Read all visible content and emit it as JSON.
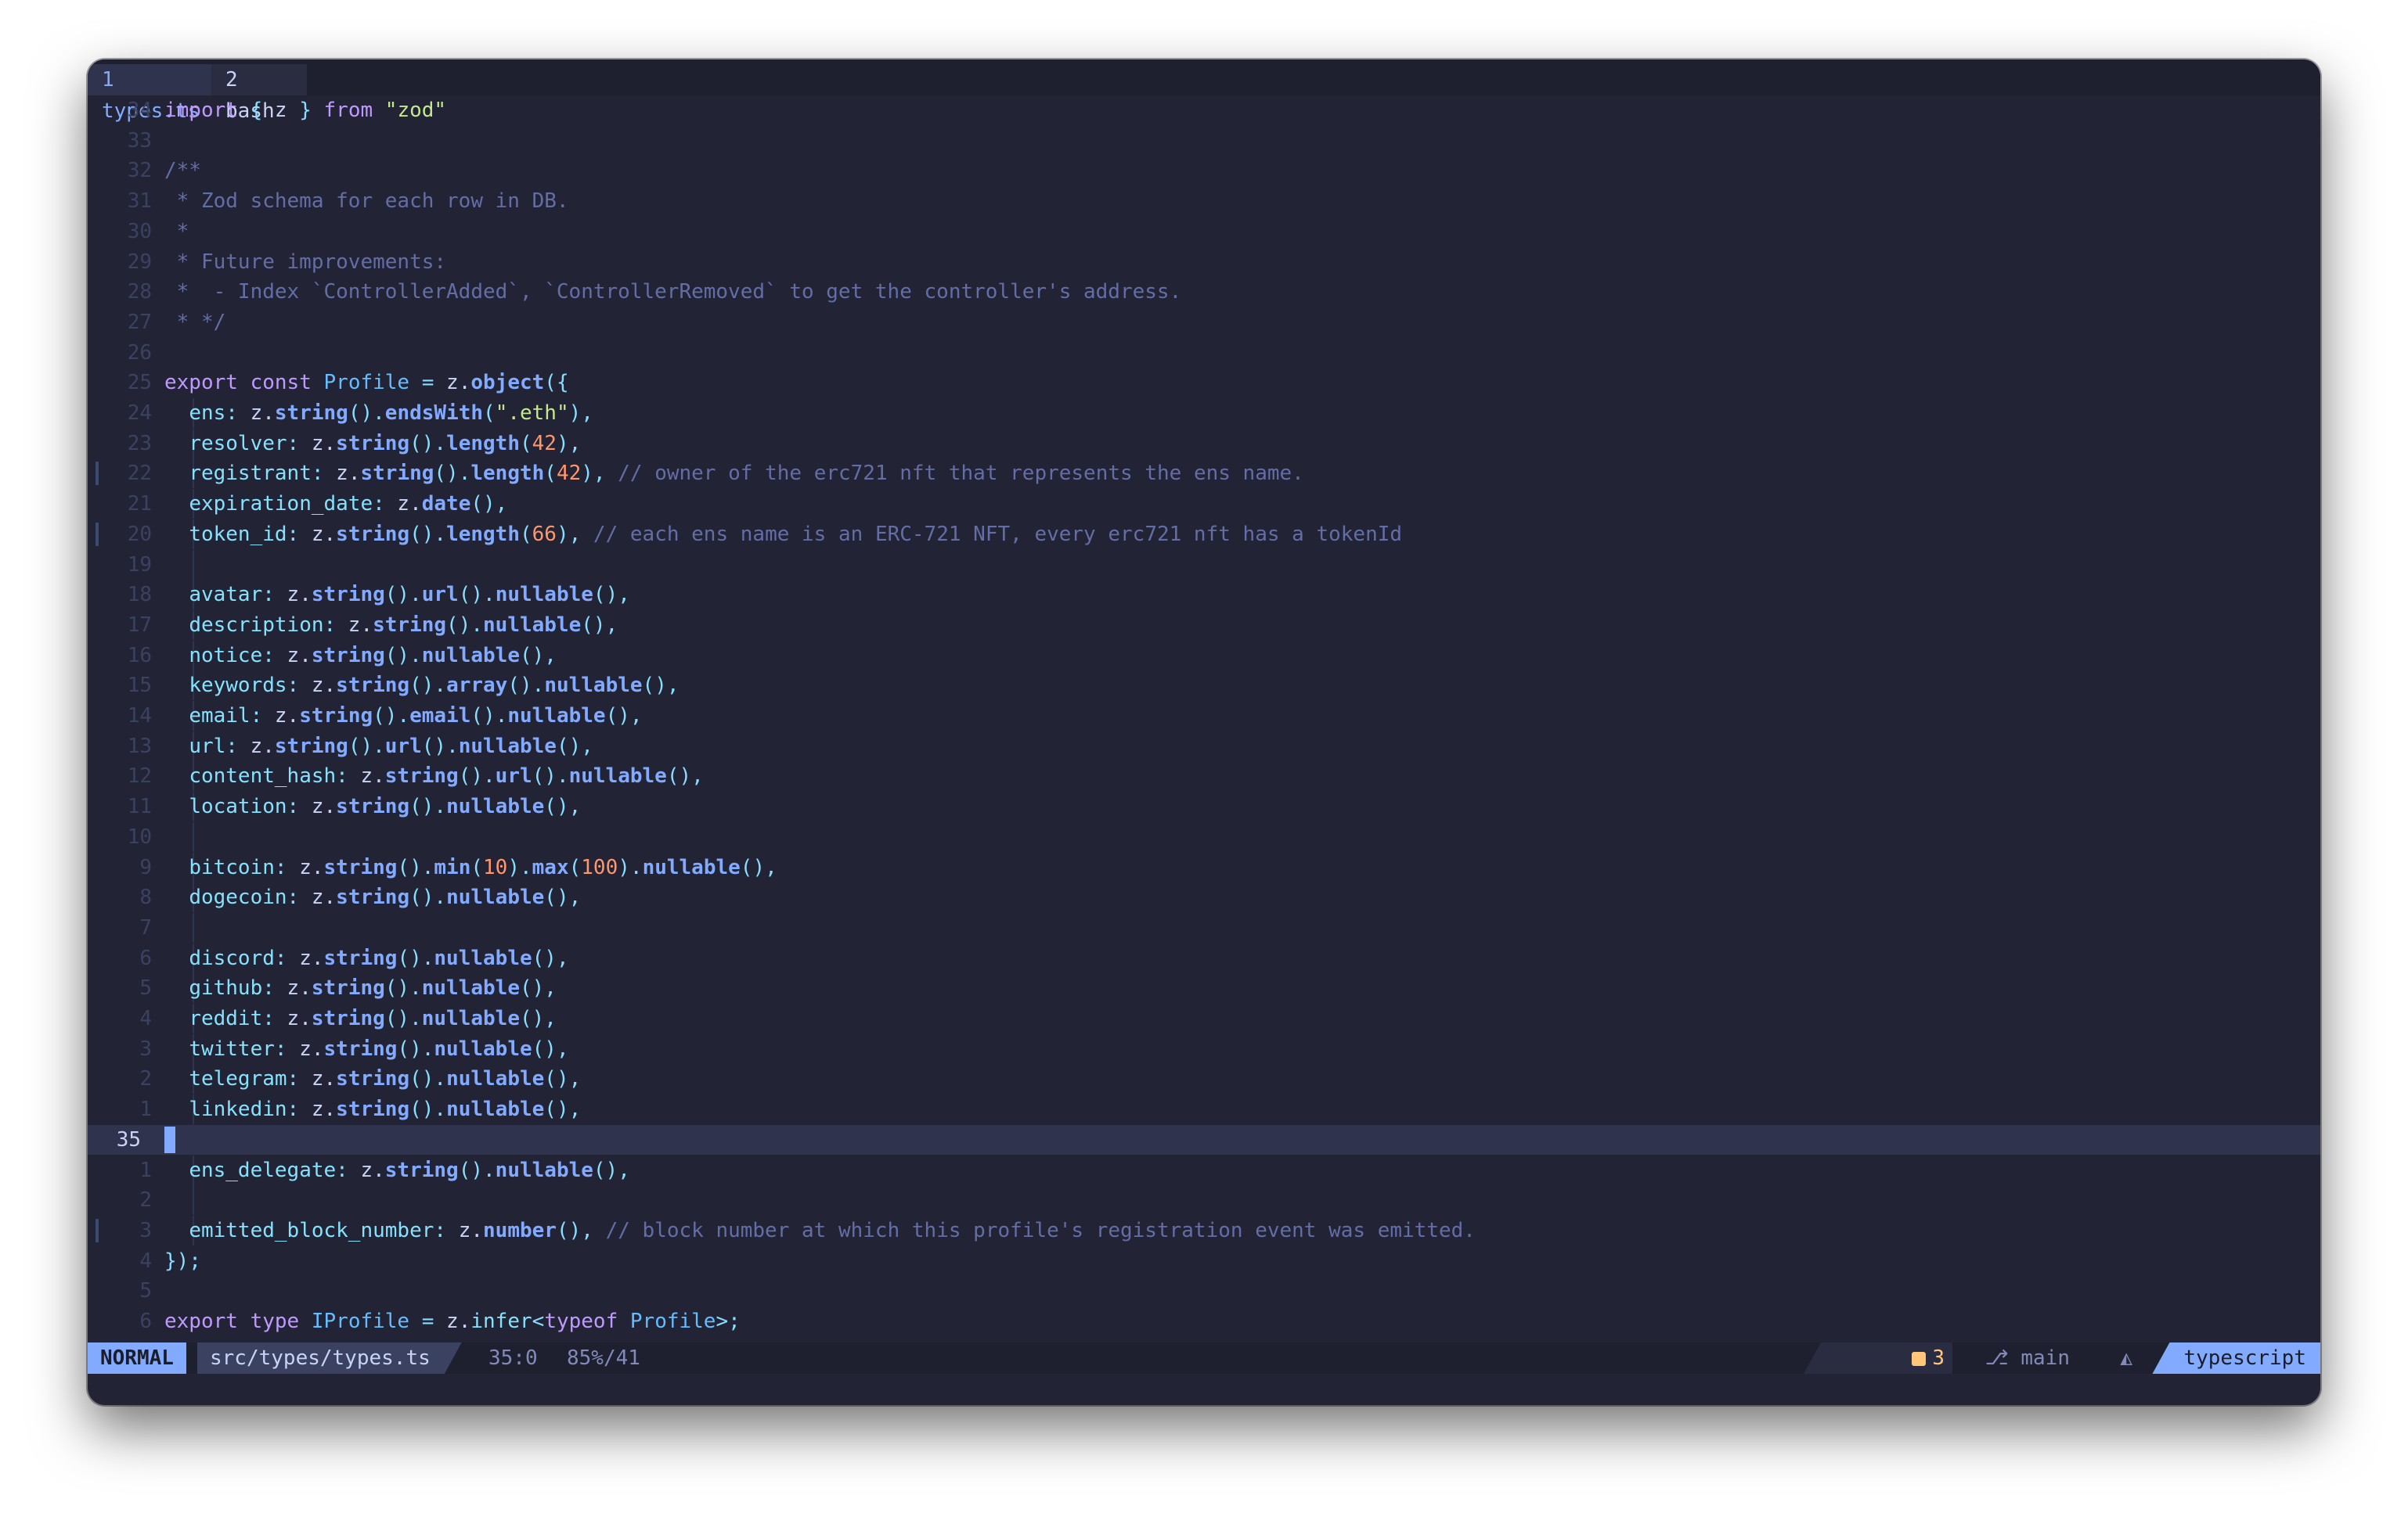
{
  "tabs": [
    {
      "label": "1 types.ts"
    },
    {
      "label": "2 bash"
    }
  ],
  "lines": [
    {
      "num": "34",
      "parts": [
        [
          "kw",
          "import"
        ],
        [
          "",
          " "
        ],
        [
          "pun",
          "{"
        ],
        [
          "",
          " z "
        ],
        [
          "pun",
          "}"
        ],
        [
          "",
          " "
        ],
        [
          "kw",
          "from"
        ],
        [
          "",
          " "
        ],
        [
          "str",
          "\"zod\""
        ]
      ]
    },
    {
      "num": "33",
      "parts": []
    },
    {
      "num": "32",
      "parts": [
        [
          "cmt",
          "/**"
        ]
      ]
    },
    {
      "num": "31",
      "parts": [
        [
          "cmt",
          " * Zod schema for each row in DB."
        ]
      ]
    },
    {
      "num": "30",
      "parts": [
        [
          "cmt",
          " *"
        ]
      ]
    },
    {
      "num": "29",
      "parts": [
        [
          "cmt",
          " * Future improvements:"
        ]
      ]
    },
    {
      "num": "28",
      "parts": [
        [
          "cmt",
          " *  - Index `ControllerAdded`, `ControllerRemoved` to get the controller's address."
        ]
      ]
    },
    {
      "num": "27",
      "parts": [
        [
          "cmt",
          " * */"
        ]
      ]
    },
    {
      "num": "26",
      "parts": []
    },
    {
      "num": "25",
      "parts": [
        [
          "kw",
          "export"
        ],
        [
          "",
          " "
        ],
        [
          "kw",
          "const"
        ],
        [
          "",
          " "
        ],
        [
          "typ",
          "Profile"
        ],
        [
          "",
          " "
        ],
        [
          "pun",
          "="
        ],
        [
          "",
          " z."
        ],
        [
          "fn",
          "object"
        ],
        [
          "pun",
          "({"
        ]
      ]
    },
    {
      "num": "24",
      "guide": true,
      "parts": [
        [
          "",
          "  "
        ],
        [
          "prop",
          "ens"
        ],
        [
          "pun",
          ":"
        ],
        [
          "",
          " z."
        ],
        [
          "fn",
          "string"
        ],
        [
          "pun",
          "()."
        ],
        [
          "fn",
          "endsWith"
        ],
        [
          "pun",
          "("
        ],
        [
          "str",
          "\".eth\""
        ],
        [
          "pun",
          "),"
        ]
      ]
    },
    {
      "num": "23",
      "guide": true,
      "parts": [
        [
          "",
          "  "
        ],
        [
          "prop",
          "resolver"
        ],
        [
          "pun",
          ":"
        ],
        [
          "",
          " z."
        ],
        [
          "fn",
          "string"
        ],
        [
          "pun",
          "()."
        ],
        [
          "fn",
          "length"
        ],
        [
          "pun",
          "("
        ],
        [
          "num",
          "42"
        ],
        [
          "pun",
          "),"
        ]
      ]
    },
    {
      "num": "22",
      "guide": true,
      "mark": true,
      "parts": [
        [
          "",
          "  "
        ],
        [
          "prop",
          "registrant"
        ],
        [
          "pun",
          ":"
        ],
        [
          "",
          " z."
        ],
        [
          "fn",
          "string"
        ],
        [
          "pun",
          "()."
        ],
        [
          "fn",
          "length"
        ],
        [
          "pun",
          "("
        ],
        [
          "num",
          "42"
        ],
        [
          "pun",
          "),"
        ],
        [
          "",
          " "
        ],
        [
          "cmt",
          "// owner of the erc721 nft that represents the ens name."
        ]
      ]
    },
    {
      "num": "21",
      "guide": true,
      "parts": [
        [
          "",
          "  "
        ],
        [
          "prop",
          "expiration_date"
        ],
        [
          "pun",
          ":"
        ],
        [
          "",
          " z."
        ],
        [
          "fn",
          "date"
        ],
        [
          "pun",
          "(),"
        ]
      ]
    },
    {
      "num": "20",
      "guide": true,
      "mark": true,
      "parts": [
        [
          "",
          "  "
        ],
        [
          "prop",
          "token_id"
        ],
        [
          "pun",
          ":"
        ],
        [
          "",
          " z."
        ],
        [
          "fn",
          "string"
        ],
        [
          "pun",
          "()."
        ],
        [
          "fn",
          "length"
        ],
        [
          "pun",
          "("
        ],
        [
          "num",
          "66"
        ],
        [
          "pun",
          "),"
        ],
        [
          "",
          " "
        ],
        [
          "cmt",
          "// each ens name is an ERC-721 NFT, every erc721 nft has a tokenId"
        ]
      ]
    },
    {
      "num": "19",
      "guide": true,
      "parts": []
    },
    {
      "num": "18",
      "guide": true,
      "parts": [
        [
          "",
          "  "
        ],
        [
          "prop",
          "avatar"
        ],
        [
          "pun",
          ":"
        ],
        [
          "",
          " z."
        ],
        [
          "fn",
          "string"
        ],
        [
          "pun",
          "()."
        ],
        [
          "fn",
          "url"
        ],
        [
          "pun",
          "()."
        ],
        [
          "fn",
          "nullable"
        ],
        [
          "pun",
          "(),"
        ]
      ]
    },
    {
      "num": "17",
      "guide": true,
      "parts": [
        [
          "",
          "  "
        ],
        [
          "prop",
          "description"
        ],
        [
          "pun",
          ":"
        ],
        [
          "",
          " z."
        ],
        [
          "fn",
          "string"
        ],
        [
          "pun",
          "()."
        ],
        [
          "fn",
          "nullable"
        ],
        [
          "pun",
          "(),"
        ]
      ]
    },
    {
      "num": "16",
      "guide": true,
      "parts": [
        [
          "",
          "  "
        ],
        [
          "prop",
          "notice"
        ],
        [
          "pun",
          ":"
        ],
        [
          "",
          " z."
        ],
        [
          "fn",
          "string"
        ],
        [
          "pun",
          "()."
        ],
        [
          "fn",
          "nullable"
        ],
        [
          "pun",
          "(),"
        ]
      ]
    },
    {
      "num": "15",
      "guide": true,
      "parts": [
        [
          "",
          "  "
        ],
        [
          "prop",
          "keywords"
        ],
        [
          "pun",
          ":"
        ],
        [
          "",
          " z."
        ],
        [
          "fn",
          "string"
        ],
        [
          "pun",
          "()."
        ],
        [
          "fn",
          "array"
        ],
        [
          "pun",
          "()."
        ],
        [
          "fn",
          "nullable"
        ],
        [
          "pun",
          "(),"
        ]
      ]
    },
    {
      "num": "14",
      "guide": true,
      "parts": [
        [
          "",
          "  "
        ],
        [
          "prop",
          "email"
        ],
        [
          "pun",
          ":"
        ],
        [
          "",
          " z."
        ],
        [
          "fn",
          "string"
        ],
        [
          "pun",
          "()."
        ],
        [
          "fn",
          "email"
        ],
        [
          "pun",
          "()."
        ],
        [
          "fn",
          "nullable"
        ],
        [
          "pun",
          "(),"
        ]
      ]
    },
    {
      "num": "13",
      "guide": true,
      "parts": [
        [
          "",
          "  "
        ],
        [
          "prop",
          "url"
        ],
        [
          "pun",
          ":"
        ],
        [
          "",
          " z."
        ],
        [
          "fn",
          "string"
        ],
        [
          "pun",
          "()."
        ],
        [
          "fn",
          "url"
        ],
        [
          "pun",
          "()."
        ],
        [
          "fn",
          "nullable"
        ],
        [
          "pun",
          "(),"
        ]
      ]
    },
    {
      "num": "12",
      "guide": true,
      "parts": [
        [
          "",
          "  "
        ],
        [
          "prop",
          "content_hash"
        ],
        [
          "pun",
          ":"
        ],
        [
          "",
          " z."
        ],
        [
          "fn",
          "string"
        ],
        [
          "pun",
          "()."
        ],
        [
          "fn",
          "url"
        ],
        [
          "pun",
          "()."
        ],
        [
          "fn",
          "nullable"
        ],
        [
          "pun",
          "(),"
        ]
      ]
    },
    {
      "num": "11",
      "guide": true,
      "parts": [
        [
          "",
          "  "
        ],
        [
          "prop",
          "location"
        ],
        [
          "pun",
          ":"
        ],
        [
          "",
          " z."
        ],
        [
          "fn",
          "string"
        ],
        [
          "pun",
          "()."
        ],
        [
          "fn",
          "nullable"
        ],
        [
          "pun",
          "(),"
        ]
      ]
    },
    {
      "num": "10",
      "guide": true,
      "parts": []
    },
    {
      "num": "9",
      "guide": true,
      "parts": [
        [
          "",
          "  "
        ],
        [
          "prop",
          "bitcoin"
        ],
        [
          "pun",
          ":"
        ],
        [
          "",
          " z."
        ],
        [
          "fn",
          "string"
        ],
        [
          "pun",
          "()."
        ],
        [
          "fn",
          "min"
        ],
        [
          "pun",
          "("
        ],
        [
          "num",
          "10"
        ],
        [
          "pun",
          ")."
        ],
        [
          "fn",
          "max"
        ],
        [
          "pun",
          "("
        ],
        [
          "num",
          "100"
        ],
        [
          "pun",
          ")."
        ],
        [
          "fn",
          "nullable"
        ],
        [
          "pun",
          "(),"
        ]
      ]
    },
    {
      "num": "8",
      "guide": true,
      "parts": [
        [
          "",
          "  "
        ],
        [
          "prop",
          "dogecoin"
        ],
        [
          "pun",
          ":"
        ],
        [
          "",
          " z."
        ],
        [
          "fn",
          "string"
        ],
        [
          "pun",
          "()."
        ],
        [
          "fn",
          "nullable"
        ],
        [
          "pun",
          "(),"
        ]
      ]
    },
    {
      "num": "7",
      "guide": true,
      "parts": []
    },
    {
      "num": "6",
      "guide": true,
      "parts": [
        [
          "",
          "  "
        ],
        [
          "prop",
          "discord"
        ],
        [
          "pun",
          ":"
        ],
        [
          "",
          " z."
        ],
        [
          "fn",
          "string"
        ],
        [
          "pun",
          "()."
        ],
        [
          "fn",
          "nullable"
        ],
        [
          "pun",
          "(),"
        ]
      ]
    },
    {
      "num": "5",
      "guide": true,
      "parts": [
        [
          "",
          "  "
        ],
        [
          "prop",
          "github"
        ],
        [
          "pun",
          ":"
        ],
        [
          "",
          " z."
        ],
        [
          "fn",
          "string"
        ],
        [
          "pun",
          "()."
        ],
        [
          "fn",
          "nullable"
        ],
        [
          "pun",
          "(),"
        ]
      ]
    },
    {
      "num": "4",
      "guide": true,
      "parts": [
        [
          "",
          "  "
        ],
        [
          "prop",
          "reddit"
        ],
        [
          "pun",
          ":"
        ],
        [
          "",
          " z."
        ],
        [
          "fn",
          "string"
        ],
        [
          "pun",
          "()."
        ],
        [
          "fn",
          "nullable"
        ],
        [
          "pun",
          "(),"
        ]
      ]
    },
    {
      "num": "3",
      "guide": true,
      "parts": [
        [
          "",
          "  "
        ],
        [
          "prop",
          "twitter"
        ],
        [
          "pun",
          ":"
        ],
        [
          "",
          " z."
        ],
        [
          "fn",
          "string"
        ],
        [
          "pun",
          "()."
        ],
        [
          "fn",
          "nullable"
        ],
        [
          "pun",
          "(),"
        ]
      ]
    },
    {
      "num": "2",
      "guide": true,
      "parts": [
        [
          "",
          "  "
        ],
        [
          "prop",
          "telegram"
        ],
        [
          "pun",
          ":"
        ],
        [
          "",
          " z."
        ],
        [
          "fn",
          "string"
        ],
        [
          "pun",
          "()."
        ],
        [
          "fn",
          "nullable"
        ],
        [
          "pun",
          "(),"
        ]
      ]
    },
    {
      "num": "1",
      "guide": true,
      "parts": [
        [
          "",
          "  "
        ],
        [
          "prop",
          "linkedin"
        ],
        [
          "pun",
          ":"
        ],
        [
          "",
          " z."
        ],
        [
          "fn",
          "string"
        ],
        [
          "pun",
          "()."
        ],
        [
          "fn",
          "nullable"
        ],
        [
          "pun",
          "(),"
        ]
      ]
    },
    {
      "num": "35",
      "current": true,
      "guide": true,
      "parts": []
    },
    {
      "num": "1",
      "guide": true,
      "parts": [
        [
          "",
          "  "
        ],
        [
          "prop",
          "ens_delegate"
        ],
        [
          "pun",
          ":"
        ],
        [
          "",
          " z."
        ],
        [
          "fn",
          "string"
        ],
        [
          "pun",
          "()."
        ],
        [
          "fn",
          "nullable"
        ],
        [
          "pun",
          "(),"
        ]
      ]
    },
    {
      "num": "2",
      "guide": true,
      "parts": []
    },
    {
      "num": "3",
      "guide": true,
      "mark": true,
      "parts": [
        [
          "",
          "  "
        ],
        [
          "prop",
          "emitted_block_number"
        ],
        [
          "pun",
          ":"
        ],
        [
          "",
          " z."
        ],
        [
          "fn",
          "number"
        ],
        [
          "pun",
          "(),"
        ],
        [
          "",
          " "
        ],
        [
          "cmt",
          "// block number at which this profile's registration event was emitted."
        ]
      ]
    },
    {
      "num": "4",
      "parts": [
        [
          "pun",
          "});"
        ]
      ]
    },
    {
      "num": "5",
      "parts": []
    },
    {
      "num": "6",
      "parts": [
        [
          "kw",
          "export"
        ],
        [
          "",
          " "
        ],
        [
          "kw",
          "type"
        ],
        [
          "",
          " "
        ],
        [
          "typ",
          "IProfile"
        ],
        [
          "",
          " "
        ],
        [
          "pun",
          "="
        ],
        [
          "",
          " z."
        ],
        [
          "prop",
          "infer"
        ],
        [
          "pun",
          "<"
        ],
        [
          "kw",
          "typeof"
        ],
        [
          "",
          " "
        ],
        [
          "typ",
          "Profile"
        ],
        [
          "pun",
          ">;"
        ]
      ]
    }
  ],
  "status": {
    "mode": "NORMAL",
    "file": "src/types/types.ts",
    "position": "35:0",
    "percent": "85%/41",
    "warnings": "3",
    "branch": "main",
    "os_icon": "linux-icon",
    "filetype": "typescript"
  }
}
